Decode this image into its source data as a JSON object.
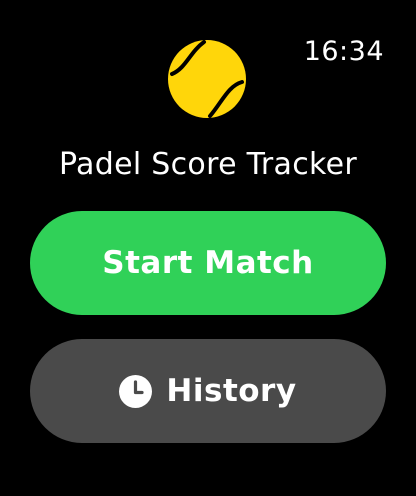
{
  "status": {
    "time": "16:34"
  },
  "app": {
    "title": "Padel Score Tracker",
    "logo_icon": "tennis-ball-icon",
    "logo_color": "#ffd60a"
  },
  "actions": {
    "start_label": "Start Match",
    "start_color": "#30d158",
    "history_label": "History",
    "history_icon": "clock-icon",
    "history_color": "#4a4a4a"
  }
}
